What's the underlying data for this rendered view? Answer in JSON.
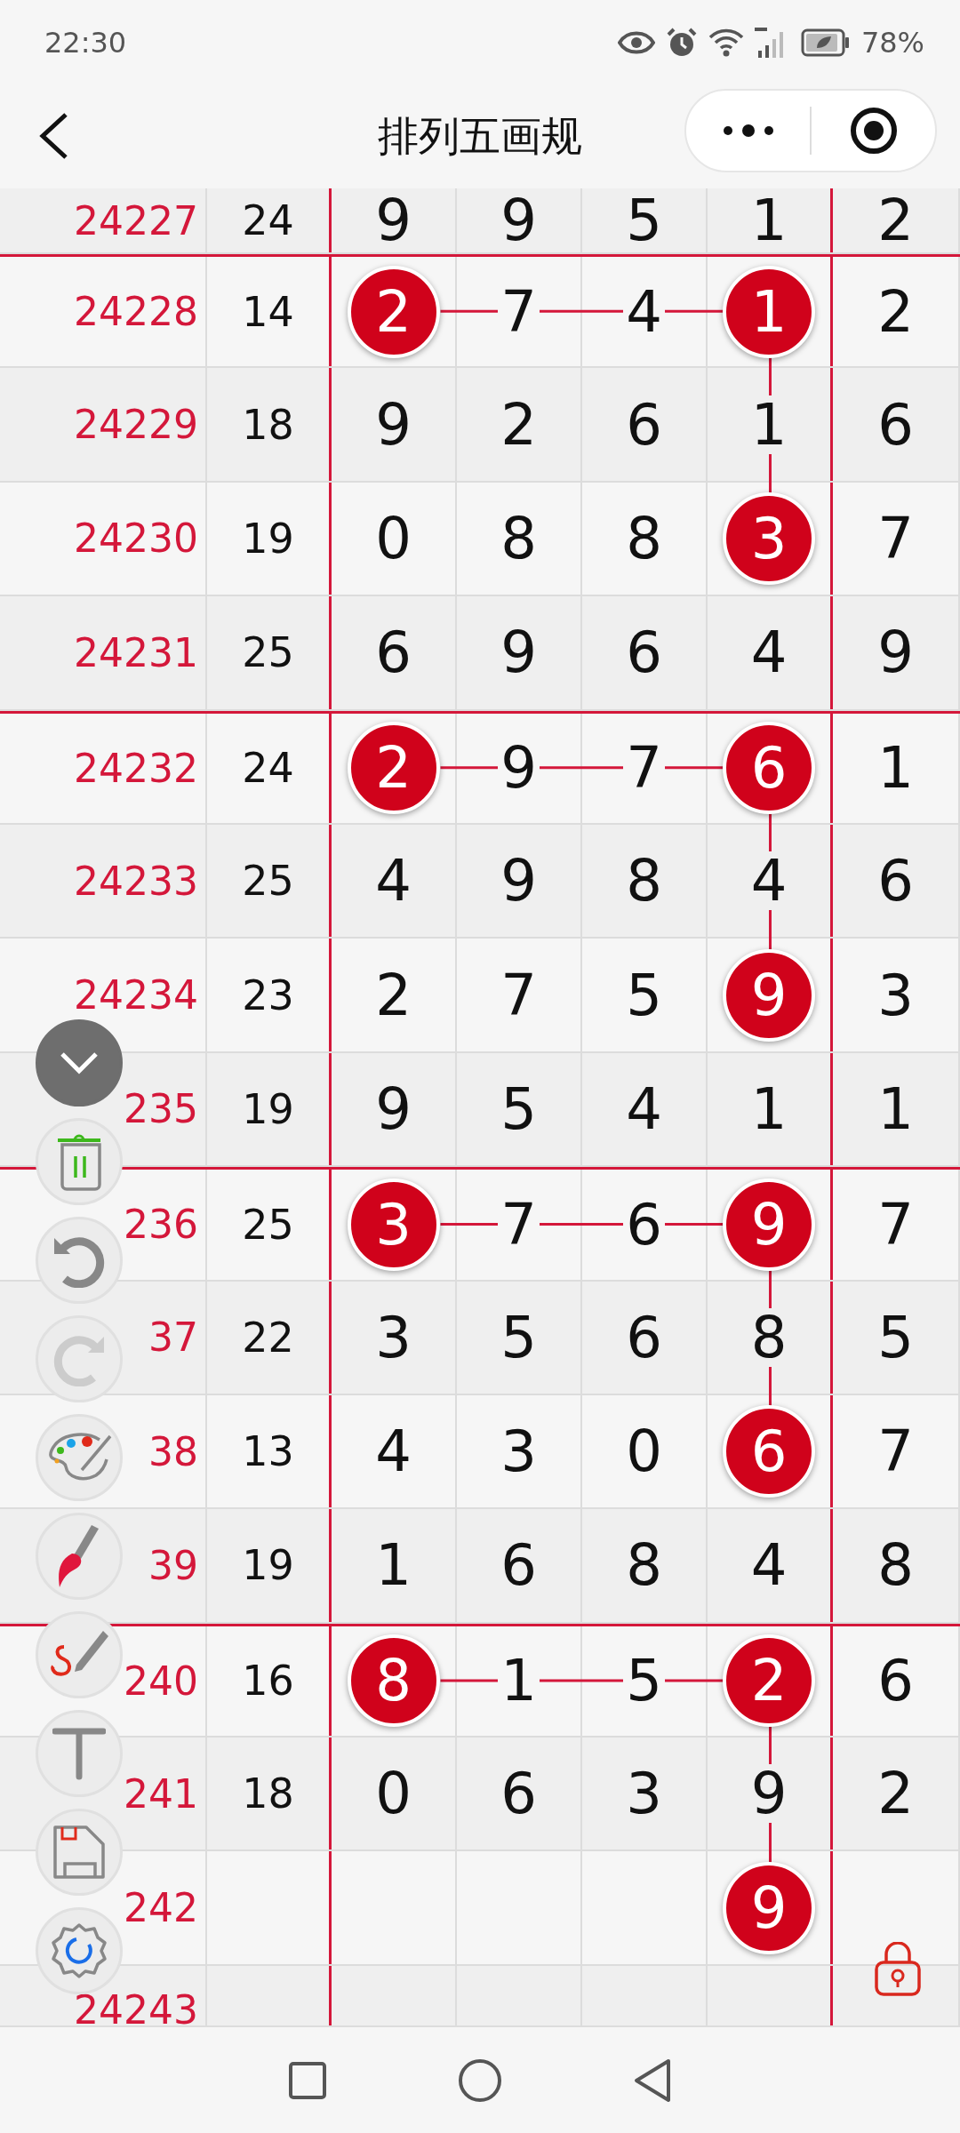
{
  "status_bar": {
    "time": "22:30",
    "battery": "78%"
  },
  "nav": {
    "title": "排列五画规"
  },
  "rows": [
    {
      "issue": "24227",
      "sum": "24",
      "group_start": false,
      "cells": [
        {
          "value": "9",
          "circled": false
        },
        {
          "value": "9",
          "circled": false
        },
        {
          "value": "5",
          "circled": false
        },
        {
          "value": "1",
          "circled": false
        },
        {
          "value": "2",
          "circled": false
        }
      ]
    },
    {
      "issue": "24228",
      "sum": "14",
      "group_start": true,
      "cells": [
        {
          "value": "2",
          "circled": true
        },
        {
          "value": "7",
          "circled": false
        },
        {
          "value": "4",
          "circled": false
        },
        {
          "value": "1",
          "circled": true
        },
        {
          "value": "2",
          "circled": false
        }
      ]
    },
    {
      "issue": "24229",
      "sum": "18",
      "group_start": false,
      "cells": [
        {
          "value": "9",
          "circled": false
        },
        {
          "value": "2",
          "circled": false
        },
        {
          "value": "6",
          "circled": false
        },
        {
          "value": "1",
          "circled": false
        },
        {
          "value": "6",
          "circled": false
        }
      ]
    },
    {
      "issue": "24230",
      "sum": "19",
      "group_start": false,
      "cells": [
        {
          "value": "0",
          "circled": false
        },
        {
          "value": "8",
          "circled": false
        },
        {
          "value": "8",
          "circled": false
        },
        {
          "value": "3",
          "circled": true
        },
        {
          "value": "7",
          "circled": false
        }
      ]
    },
    {
      "issue": "24231",
      "sum": "25",
      "group_start": false,
      "cells": [
        {
          "value": "6",
          "circled": false
        },
        {
          "value": "9",
          "circled": false
        },
        {
          "value": "6",
          "circled": false
        },
        {
          "value": "4",
          "circled": false
        },
        {
          "value": "9",
          "circled": false
        }
      ]
    },
    {
      "issue": "24232",
      "sum": "24",
      "group_start": true,
      "cells": [
        {
          "value": "2",
          "circled": true
        },
        {
          "value": "9",
          "circled": false
        },
        {
          "value": "7",
          "circled": false
        },
        {
          "value": "6",
          "circled": true
        },
        {
          "value": "1",
          "circled": false
        }
      ]
    },
    {
      "issue": "24233",
      "sum": "25",
      "group_start": false,
      "cells": [
        {
          "value": "4",
          "circled": false
        },
        {
          "value": "9",
          "circled": false
        },
        {
          "value": "8",
          "circled": false
        },
        {
          "value": "4",
          "circled": false
        },
        {
          "value": "6",
          "circled": false
        }
      ]
    },
    {
      "issue": "24234",
      "sum": "23",
      "group_start": false,
      "cells": [
        {
          "value": "2",
          "circled": false
        },
        {
          "value": "7",
          "circled": false
        },
        {
          "value": "5",
          "circled": false
        },
        {
          "value": "9",
          "circled": true
        },
        {
          "value": "3",
          "circled": false
        }
      ]
    },
    {
      "issue": "235",
      "sum": "19",
      "group_start": false,
      "cells": [
        {
          "value": "9",
          "circled": false
        },
        {
          "value": "5",
          "circled": false
        },
        {
          "value": "4",
          "circled": false
        },
        {
          "value": "1",
          "circled": false
        },
        {
          "value": "1",
          "circled": false
        }
      ]
    },
    {
      "issue": "236",
      "sum": "25",
      "group_start": true,
      "cells": [
        {
          "value": "3",
          "circled": true
        },
        {
          "value": "7",
          "circled": false
        },
        {
          "value": "6",
          "circled": false
        },
        {
          "value": "9",
          "circled": true
        },
        {
          "value": "7",
          "circled": false
        }
      ]
    },
    {
      "issue": "37",
      "sum": "22",
      "group_start": false,
      "cells": [
        {
          "value": "3",
          "circled": false
        },
        {
          "value": "5",
          "circled": false
        },
        {
          "value": "6",
          "circled": false
        },
        {
          "value": "8",
          "circled": false
        },
        {
          "value": "5",
          "circled": false
        }
      ]
    },
    {
      "issue": "38",
      "sum": "13",
      "group_start": false,
      "cells": [
        {
          "value": "4",
          "circled": false
        },
        {
          "value": "3",
          "circled": false
        },
        {
          "value": "0",
          "circled": false
        },
        {
          "value": "6",
          "circled": true
        },
        {
          "value": "7",
          "circled": false
        }
      ]
    },
    {
      "issue": "39",
      "sum": "19",
      "group_start": false,
      "cells": [
        {
          "value": "1",
          "circled": false
        },
        {
          "value": "6",
          "circled": false
        },
        {
          "value": "8",
          "circled": false
        },
        {
          "value": "4",
          "circled": false
        },
        {
          "value": "8",
          "circled": false
        }
      ]
    },
    {
      "issue": "240",
      "sum": "16",
      "group_start": true,
      "cells": [
        {
          "value": "8",
          "circled": true
        },
        {
          "value": "1",
          "circled": false
        },
        {
          "value": "5",
          "circled": false
        },
        {
          "value": "2",
          "circled": true
        },
        {
          "value": "6",
          "circled": false
        }
      ]
    },
    {
      "issue": "241",
      "sum": "18",
      "group_start": false,
      "cells": [
        {
          "value": "0",
          "circled": false
        },
        {
          "value": "6",
          "circled": false
        },
        {
          "value": "3",
          "circled": false
        },
        {
          "value": "9",
          "circled": false
        },
        {
          "value": "2",
          "circled": false
        }
      ]
    },
    {
      "issue": "242",
      "group_start": false,
      "cells": [
        null,
        null,
        null,
        {
          "value": "9",
          "circled": true
        },
        null
      ]
    },
    {
      "issue": "24243",
      "group_start": false
    }
  ],
  "toolbar": [
    {
      "kind": "collapse",
      "disabled": false
    },
    {
      "kind": "trash",
      "disabled": false
    },
    {
      "kind": "undo",
      "disabled": false
    },
    {
      "kind": "redo",
      "disabled": true
    },
    {
      "kind": "palette",
      "disabled": false
    },
    {
      "kind": "brush",
      "disabled": false
    },
    {
      "kind": "pen",
      "disabled": false
    },
    {
      "kind": "text",
      "disabled": false
    },
    {
      "kind": "save",
      "disabled": false
    },
    {
      "kind": "settings",
      "disabled": false
    }
  ]
}
